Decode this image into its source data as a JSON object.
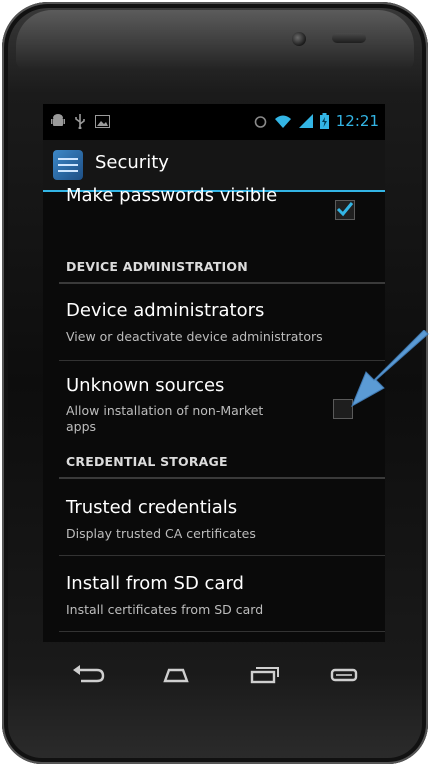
{
  "status_bar": {
    "time": "12:21",
    "left_icons": [
      "android-debug-icon",
      "usb-icon",
      "image-icon"
    ],
    "right_icons": [
      "alarm-icon",
      "wifi-icon",
      "signal-icon",
      "battery-icon"
    ]
  },
  "action_bar": {
    "title": "Security",
    "icon": "settings-app-icon"
  },
  "preferences": {
    "make_passwords_visible": {
      "title": "Make passwords visible",
      "checked": true
    },
    "device_admin_header": "DEVICE ADMINISTRATION",
    "device_administrators": {
      "title": "Device administrators",
      "summary": "View or deactivate device administrators"
    },
    "unknown_sources": {
      "title": "Unknown sources",
      "summary_line1": "Allow installation of non-Market",
      "summary_line2": "apps",
      "checked": false
    },
    "credential_storage_header": "CREDENTIAL STORAGE",
    "trusted_credentials": {
      "title": "Trusted credentials",
      "summary": "Display trusted CA certificates"
    },
    "install_from_sd": {
      "title": "Install from SD card",
      "summary": "Install certificates from SD card"
    }
  },
  "nav_bar": {
    "buttons": [
      "back-icon",
      "home-icon",
      "recent-apps-icon",
      "menu-icon"
    ]
  },
  "colors": {
    "accent": "#33b5e5",
    "arrow": "#5b9bd5"
  }
}
